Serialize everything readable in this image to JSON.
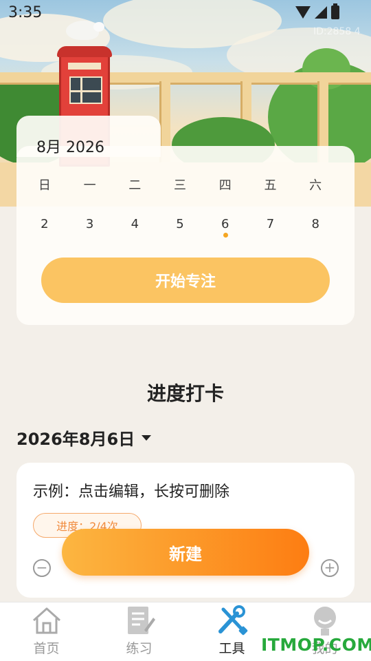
{
  "status_bar": {
    "time": "3:35"
  },
  "header": {
    "id_text": "ID:2858 4"
  },
  "calendar": {
    "month_label": "8月 2026",
    "weekdays": [
      "日",
      "一",
      "二",
      "三",
      "四",
      "五",
      "六"
    ],
    "days": [
      "2",
      "3",
      "4",
      "5",
      "6",
      "7",
      "8"
    ],
    "today": "6",
    "start_label": "开始专注",
    "accent": "#f5a623"
  },
  "progress": {
    "title": "进度打卡",
    "date": "2026年8月6日",
    "task": {
      "title": "示例：点击编辑，长按可删除",
      "progress_text": "进度：2/4次",
      "minus": "−",
      "plus": "+"
    },
    "new_label": "新建"
  },
  "nav": {
    "items": [
      {
        "label": "首页",
        "icon": "home-icon"
      },
      {
        "label": "练习",
        "icon": "document-icon"
      },
      {
        "label": "工具",
        "icon": "tools-icon"
      },
      {
        "label": "我的",
        "icon": "profile-icon"
      }
    ],
    "active_index": 2
  },
  "watermark": "ITMOP.COM",
  "colors": {
    "orange_start": "#fcb641",
    "orange_end": "#fd7d12",
    "tool_blue": "#2a93d5",
    "watermark_green": "#27a93c"
  }
}
